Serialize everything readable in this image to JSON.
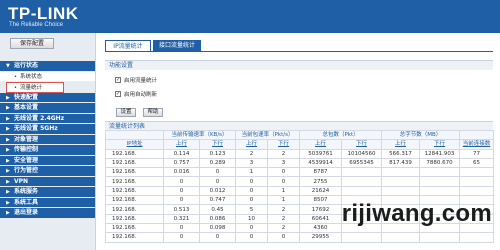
{
  "header": {
    "logo": "TP-LINK",
    "slogan": "The Reliable Choice"
  },
  "sidebar": {
    "save_label": "保存配置",
    "items": [
      {
        "label": "运行状态",
        "expanded": true
      },
      {
        "label": "系统状态",
        "sub": true
      },
      {
        "label": "流量统计",
        "sub": true,
        "active": true
      },
      {
        "label": "快速配置"
      },
      {
        "label": "基本设置"
      },
      {
        "label": "无线设置 2.4GHz"
      },
      {
        "label": "无线设置 5GHz"
      },
      {
        "label": "对象管理"
      },
      {
        "label": "传输控制"
      },
      {
        "label": "安全管理"
      },
      {
        "label": "行为管控"
      },
      {
        "label": "VPN"
      },
      {
        "label": "系统服务"
      },
      {
        "label": "系统工具"
      },
      {
        "label": "退出登录"
      }
    ]
  },
  "tabs": [
    {
      "label": "IP流量统计",
      "active": true
    },
    {
      "label": "接口流量统计",
      "active": false
    }
  ],
  "function_settings": {
    "title": "功能设置",
    "enable_stats": "启用流量统计",
    "auto_refresh": "启用自动刷新",
    "settings_button": "设置",
    "help_button": "帮助"
  },
  "stats_table": {
    "title": "流量统计列表",
    "columns_top": [
      "",
      "当前传输速率（KB/s）",
      "",
      "当前包速率（Pkt/s）",
      "",
      "总包数（Pkt）",
      "",
      "总字节数（MB）",
      "",
      ""
    ],
    "columns": [
      "IP地址",
      "上行",
      "下行",
      "上行",
      "下行",
      "上行",
      "下行",
      "上行",
      "下行",
      "当前连接数"
    ],
    "rows": [
      [
        "192.168.",
        "0.114",
        "0.123",
        "2",
        "2",
        "5039761",
        "10104560",
        "566.317",
        "12841.903",
        "77"
      ],
      [
        "192.168.",
        "0.757",
        "0.289",
        "3",
        "3",
        "4539914",
        "6955345",
        "817.439",
        "7880.670",
        "65"
      ],
      [
        "192.168.",
        "0.016",
        "0",
        "1",
        "0",
        "8787",
        "",
        "",
        "",
        ""
      ],
      [
        "192.168.",
        "0",
        "0",
        "0",
        "0",
        "2755",
        "",
        "",
        "",
        ""
      ],
      [
        "192.168.",
        "0",
        "0.012",
        "0",
        "1",
        "21624",
        "",
        "",
        "",
        ""
      ],
      [
        "192.168.",
        "0",
        "0.747",
        "0",
        "1",
        "8507",
        "",
        "",
        "",
        ""
      ],
      [
        "192.168.",
        "0.513",
        "0.45",
        "5",
        "2",
        "17692",
        "",
        "",
        "",
        ""
      ],
      [
        "192.168.",
        "0.321",
        "0.086",
        "10",
        "2",
        "60641",
        "",
        "",
        "",
        ""
      ],
      [
        "192.168.",
        "0",
        "0.098",
        "0",
        "2",
        "4360",
        "",
        "",
        "",
        ""
      ],
      [
        "192.168.",
        "0",
        "0",
        "0",
        "0",
        "29955",
        "",
        "",
        "",
        ""
      ]
    ]
  },
  "watermark": "rijiwang.com"
}
